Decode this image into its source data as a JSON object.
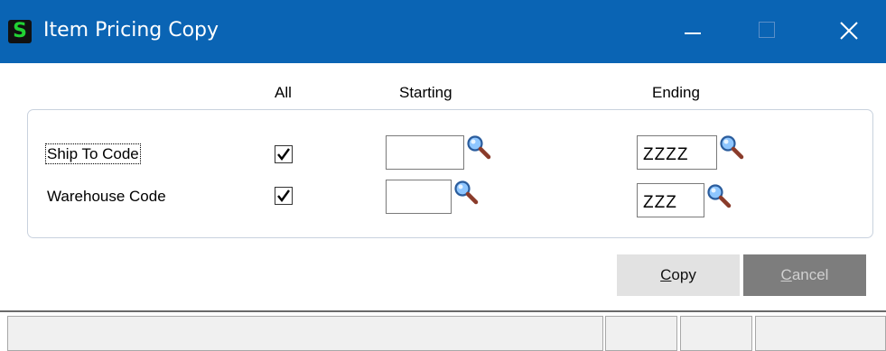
{
  "window": {
    "title": "Item Pricing Copy",
    "app_icon_letter": "S",
    "accent_color": "#0a64b4"
  },
  "headers": {
    "all": "All",
    "starting": "Starting",
    "ending": "Ending"
  },
  "rows": [
    {
      "label": "Ship To Code",
      "all_checked": true,
      "starting_value": "",
      "ending_value": "ZZZZ"
    },
    {
      "label": "Warehouse Code",
      "all_checked": true,
      "starting_value": "",
      "ending_value": "ZZZ"
    }
  ],
  "buttons": {
    "copy_label": "Copy",
    "copy_mnemonic": "C",
    "copy_rest": "opy",
    "cancel_label": "Cancel",
    "cancel_mnemonic": "C",
    "cancel_rest": "ancel"
  },
  "icons": {
    "lookup": "magnifier-icon",
    "checkbox_mark": "checkmark-icon",
    "close": "close-icon",
    "minimize": "minimize-icon",
    "maximize": "maximize-icon"
  }
}
